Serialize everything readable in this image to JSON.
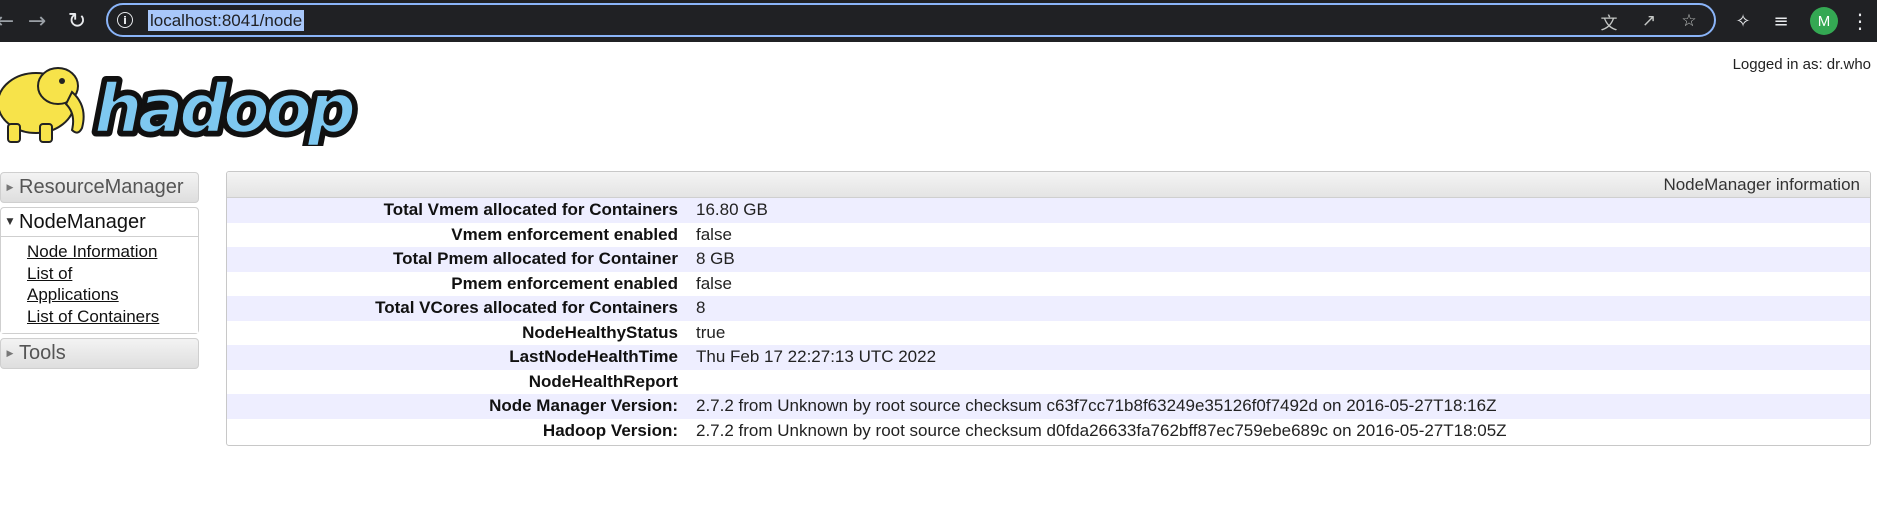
{
  "browser": {
    "url": "localhost:8041/node",
    "profile_initial": "M",
    "icons": [
      "back-arrow-icon",
      "forward-arrow-icon",
      "reload-icon",
      "info-icon",
      "translate-icon",
      "share-icon",
      "star-icon",
      "extensions-icon",
      "media-icon",
      "menu-icon"
    ]
  },
  "header": {
    "logged_in": "Logged in as: dr.who",
    "logo_text": "hadoop"
  },
  "sidebar": {
    "sections": [
      {
        "label": "ResourceManager",
        "expanded": false
      },
      {
        "label": "NodeManager",
        "expanded": true,
        "links": [
          "Node Information",
          "List of Applications",
          "List of Containers"
        ]
      },
      {
        "label": "Tools",
        "expanded": false
      }
    ]
  },
  "info": {
    "caption": "NodeManager information",
    "rows": [
      {
        "key": "Total Vmem allocated for Containers",
        "value": "16.80 GB"
      },
      {
        "key": "Vmem enforcement enabled",
        "value": "false"
      },
      {
        "key": "Total Pmem allocated for Container",
        "value": "8 GB"
      },
      {
        "key": "Pmem enforcement enabled",
        "value": "false"
      },
      {
        "key": "Total VCores allocated for Containers",
        "value": "8"
      },
      {
        "key": "NodeHealthyStatus",
        "value": "true"
      },
      {
        "key": "LastNodeHealthTime",
        "value": "Thu Feb 17 22:27:13 UTC 2022"
      },
      {
        "key": "NodeHealthReport",
        "value": ""
      },
      {
        "key": "Node Manager Version:",
        "value": "2.7.2 from Unknown by root source checksum c63f7cc71b8f63249e35126f0f7492d on 2016-05-27T18:16Z"
      },
      {
        "key": "Hadoop Version:",
        "value": "2.7.2 from Unknown by root source checksum d0fda26633fa762bff87ec759ebe689c on 2016-05-27T18:05Z"
      }
    ]
  }
}
